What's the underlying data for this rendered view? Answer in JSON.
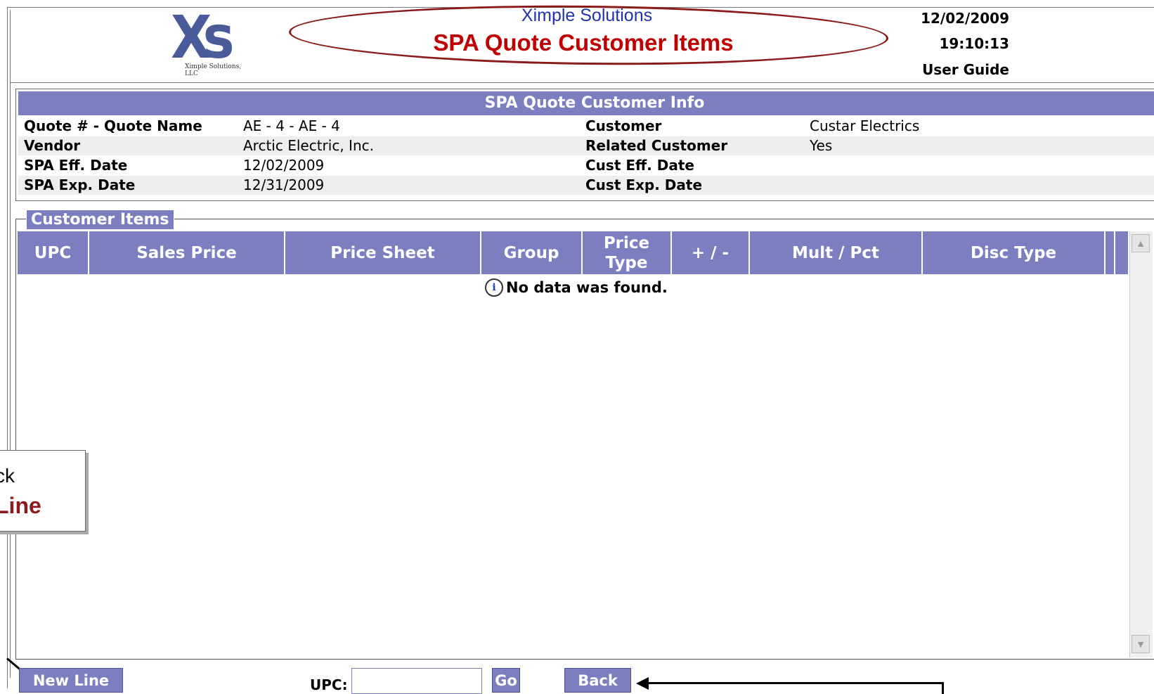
{
  "header": {
    "logo_text": "Xs",
    "logo_sub": "Ximple Solutions, LLC",
    "company": "Ximple Solutions",
    "title": "SPA Quote Customer Items",
    "date": "12/02/2009",
    "time": "19:10:13",
    "user_guide": "User Guide"
  },
  "info": {
    "heading": "SPA Quote Customer Info",
    "rows": [
      {
        "l1": "Quote # - Quote Name",
        "v1": "AE - 4 - AE - 4",
        "l2": "Customer",
        "v2": "Custar Electrics"
      },
      {
        "l1": "Vendor",
        "v1": "Arctic Electric, Inc.",
        "l2": "Related Customer",
        "v2": "Yes"
      },
      {
        "l1": "SPA Eff. Date",
        "v1": "12/02/2009",
        "l2": "Cust Eff. Date",
        "v2": ""
      },
      {
        "l1": "SPA Exp. Date",
        "v1": "12/31/2009",
        "l2": "Cust Exp. Date",
        "v2": ""
      }
    ]
  },
  "items": {
    "legend": "Customer Items",
    "columns": [
      "UPC",
      "Sales Price",
      "Price Sheet",
      "Group",
      "Price Type",
      "+ / -",
      "Mult / Pct",
      "Disc Type"
    ],
    "empty_message": "No data was found."
  },
  "callout": {
    "line1": "ck",
    "line2": "Line"
  },
  "controls": {
    "new_line": "New Line",
    "upc_label": "UPC:",
    "upc_value": "",
    "go": "Go",
    "back": "Back"
  },
  "colors": {
    "accent": "#7b7fc0",
    "title_red": "#c00000",
    "company_blue": "#2233aa"
  }
}
